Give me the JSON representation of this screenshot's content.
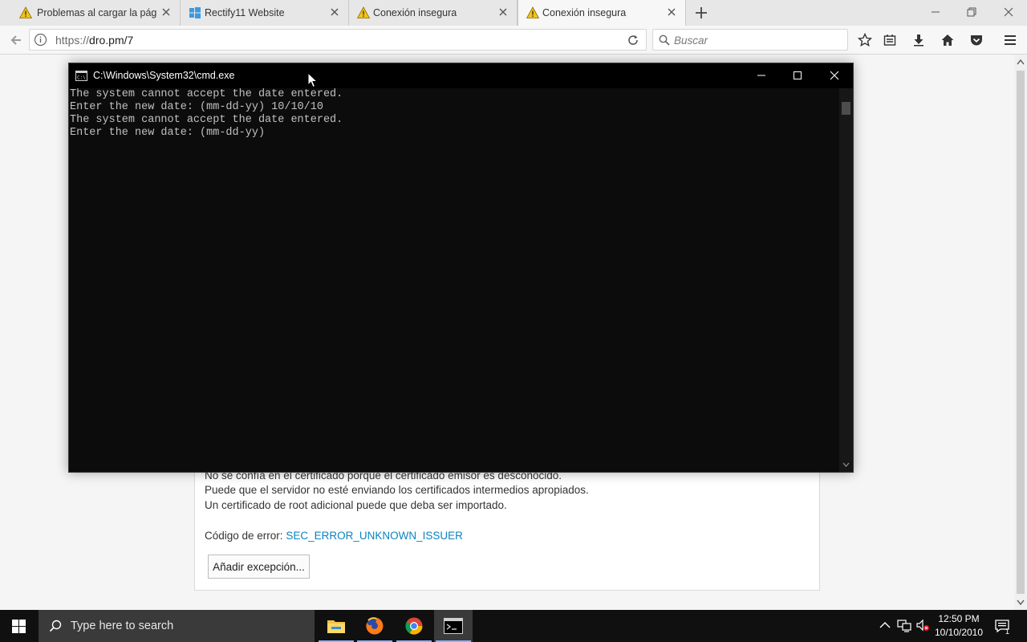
{
  "browser": {
    "tabs": [
      {
        "label": "Problemas al cargar la pág...",
        "icon": "warning-icon"
      },
      {
        "label": "Rectify11 Website",
        "icon": "windows-logo-icon"
      },
      {
        "label": "Conexión insegura",
        "icon": "warning-icon"
      },
      {
        "label": "Conexión insegura",
        "icon": "warning-icon",
        "active": true
      }
    ],
    "url_scheme": "https://",
    "url_host": "dro.pm/7",
    "search_placeholder": "Buscar"
  },
  "error_page": {
    "line_cut": "No se confía en el certificado porque el certificado emisor es desconocido.",
    "line_1": "Puede que el servidor no esté enviando los certificados intermedios apropiados.",
    "line_2": "Un certificado de root adicional puede que deba ser importado.",
    "error_label": "Código de error: ",
    "error_code": "SEC_ERROR_UNKNOWN_ISSUER",
    "add_exception_label": "Añadir excepción..."
  },
  "cmd": {
    "title": "C:\\Windows\\System32\\cmd.exe",
    "lines": [
      "The system cannot accept the date entered.",
      "Enter the new date: (mm-dd-yy) 10/10/10",
      "The system cannot accept the date entered.",
      "Enter the new date: (mm-dd-yy)"
    ]
  },
  "taskbar": {
    "search_placeholder": "Type here to search",
    "apps": [
      "file-explorer-icon",
      "firefox-icon",
      "chrome-icon",
      "cmd-icon"
    ],
    "time": "12:50 PM",
    "date": "10/10/2010",
    "notification_count": "1"
  },
  "colors": {
    "link": "#0a84c0",
    "warning": "#f3c316",
    "terminal_bg": "#0c0c0c",
    "terminal_fg": "#c0c0c0"
  }
}
